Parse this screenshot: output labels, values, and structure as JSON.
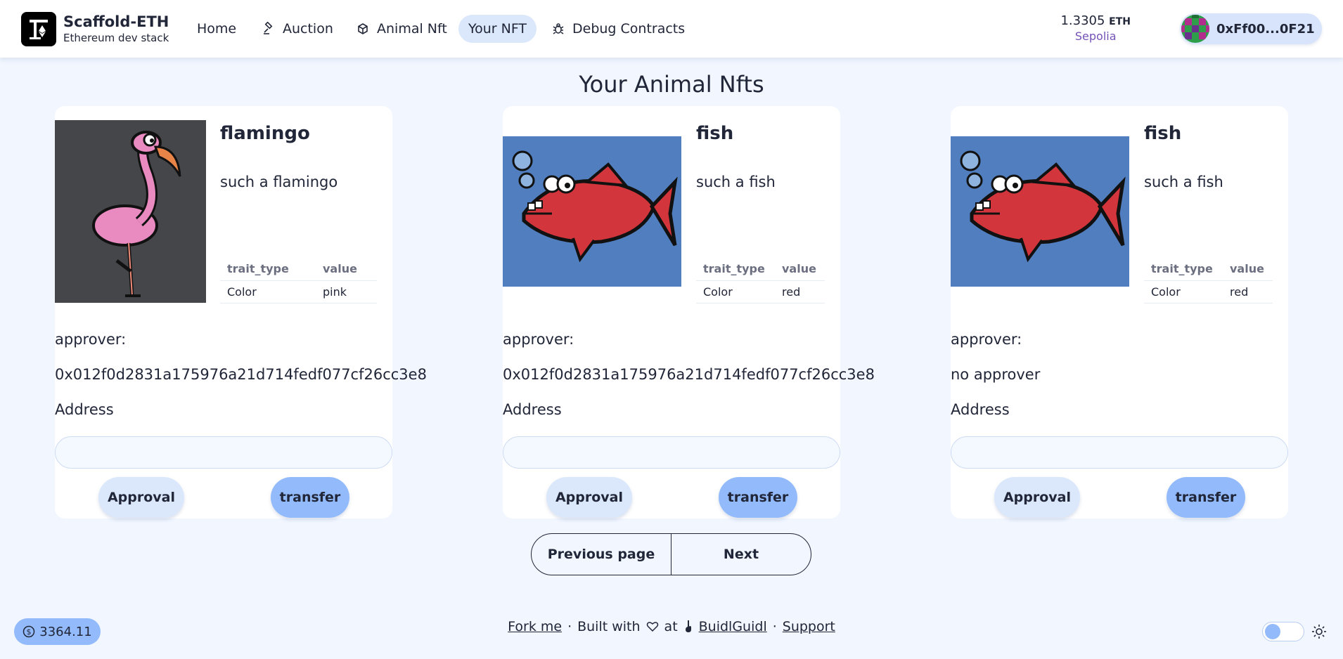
{
  "header": {
    "brand_name": "Scaffold-ETH",
    "brand_sub": "Ethereum dev stack",
    "nav": [
      {
        "label": "Home",
        "icon": "none",
        "active": false
      },
      {
        "label": "Auction",
        "icon": "gavel-icon",
        "active": false
      },
      {
        "label": "Animal Nft",
        "icon": "cube-icon",
        "active": false
      },
      {
        "label": "Your NFT",
        "icon": "none",
        "active": true
      },
      {
        "label": "Debug Contracts",
        "icon": "bug-icon",
        "active": false
      }
    ],
    "balance_value": "1.3305",
    "balance_unit": "ETH",
    "network": "Sepolia",
    "account": "0xFf00...0F21"
  },
  "page_title": "Your Animal Nfts",
  "table_headers": {
    "trait": "trait_type",
    "value": "value"
  },
  "cards": [
    {
      "name": "flamingo",
      "description": "such a flamingo",
      "trait_type": "Color",
      "trait_value": "pink",
      "approver_label": "approver:",
      "approver": "0x012f0d2831a175976a21d714fedf077cf26cc3e8",
      "address_label": "Address",
      "address_value": "",
      "approve_label": "Approval",
      "transfer_label": "transfer"
    },
    {
      "name": "fish",
      "description": "such a fish",
      "trait_type": "Color",
      "trait_value": "red",
      "approver_label": "approver:",
      "approver": "0x012f0d2831a175976a21d714fedf077cf26cc3e8",
      "address_label": "Address",
      "address_value": "",
      "approve_label": "Approval",
      "transfer_label": "transfer"
    },
    {
      "name": "fish",
      "description": "such a fish",
      "trait_type": "Color",
      "trait_value": "red",
      "approver_label": "approver:",
      "approver": "no approver",
      "address_label": "Address",
      "address_value": "",
      "approve_label": "Approval",
      "transfer_label": "transfer"
    }
  ],
  "pagination": {
    "prev": "Previous page",
    "next": "Next"
  },
  "footer": {
    "price": "3364.11",
    "fork": "Fork me",
    "sep": "·",
    "built_with": "Built with",
    "at": "at",
    "buidl": "BuidlGuidl",
    "support": "Support"
  },
  "colors": {
    "accent": "#93bbfb",
    "active_nav": "#dbe8fc",
    "background": "#f1f6ff",
    "network": "#7353b8"
  }
}
